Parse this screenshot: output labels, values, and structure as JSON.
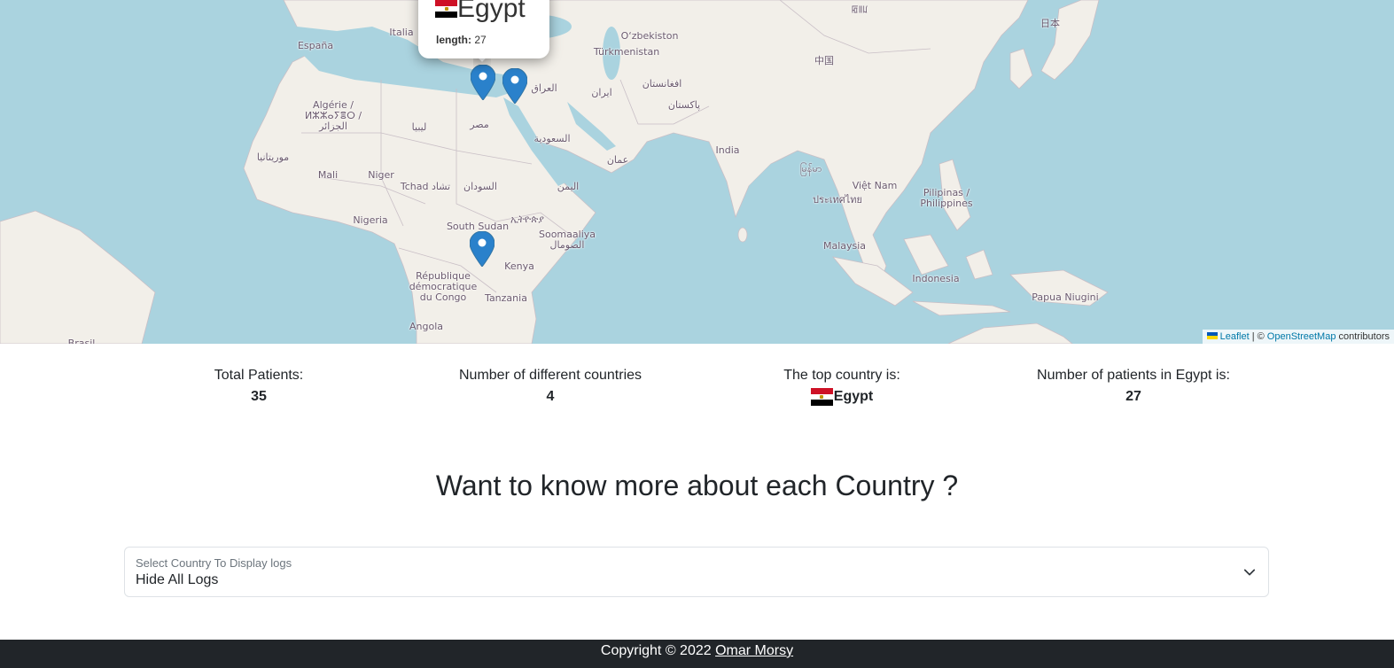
{
  "map": {
    "labels": [
      {
        "text": "España",
        "id": "label-espana"
      },
      {
        "text": "Italia",
        "id": "label-italia"
      },
      {
        "text": "O‘zbekiston",
        "id": "label-uzbekistan"
      },
      {
        "text": "Türkmenistan",
        "id": "label-turkmenistan"
      },
      {
        "text": "中国",
        "id": "label-china"
      },
      {
        "text": "日本",
        "id": "label-japan"
      },
      {
        "text": "ꡂ꡷ꡊ",
        "id": "label-mongolia"
      },
      {
        "text": "العراق",
        "id": "label-iraq"
      },
      {
        "text": "ایران",
        "id": "label-iran"
      },
      {
        "text": "افغانستان",
        "id": "label-afghanistan"
      },
      {
        "text": "پاکستان",
        "id": "label-pakistan"
      },
      {
        "text": "Algérie /\nⵍⵣⵣⴰⵢⴻⵔ /\nالجزائر",
        "id": "label-algeria"
      },
      {
        "text": "ليبيا",
        "id": "label-libya"
      },
      {
        "text": "مصر",
        "id": "label-egypt"
      },
      {
        "text": "السعودية",
        "id": "label-saudi"
      },
      {
        "text": "عمان",
        "id": "label-oman"
      },
      {
        "text": "India",
        "id": "label-india"
      },
      {
        "text": "မြန်မာ",
        "id": "label-myanmar"
      },
      {
        "text": "Việt Nam",
        "id": "label-vietnam"
      },
      {
        "text": "Pilipinas /\nPhilippines",
        "id": "label-philippines"
      },
      {
        "text": "ประเทศไทย",
        "id": "label-thailand"
      },
      {
        "text": "موريتانيا",
        "id": "label-mauritania"
      },
      {
        "text": "Mali",
        "id": "label-mali"
      },
      {
        "text": "Niger",
        "id": "label-niger"
      },
      {
        "text": "Tchad تشاد",
        "id": "label-chad"
      },
      {
        "text": "السودان",
        "id": "label-sudan"
      },
      {
        "text": "اليمن",
        "id": "label-yemen"
      },
      {
        "text": "Nigeria",
        "id": "label-nigeria"
      },
      {
        "text": "ኢትዮጵያ",
        "id": "label-ethiopia"
      },
      {
        "text": "South Sudan",
        "id": "label-south-sudan"
      },
      {
        "text": "Soomaaliya\nالصومال",
        "id": "label-somalia"
      },
      {
        "text": "Malaysia",
        "id": "label-malaysia"
      },
      {
        "text": "Kenya",
        "id": "label-kenya"
      },
      {
        "text": "République\ndémocratique\ndu Congo",
        "id": "label-drc"
      },
      {
        "text": "Tanzania",
        "id": "label-tanzania"
      },
      {
        "text": "Indonesia",
        "id": "label-indonesia"
      },
      {
        "text": "Papua Niugini",
        "id": "label-png"
      },
      {
        "text": "Angola",
        "id": "label-angola"
      },
      {
        "text": "Brasil",
        "id": "label-brasil"
      }
    ],
    "popup": {
      "title": "Egypt",
      "line_label": "length:",
      "line_value": "27"
    },
    "attribution": {
      "leaflet": "Leaflet",
      "separator": "| ©",
      "osm": "OpenStreetMap",
      "suffix": "contributors"
    }
  },
  "stats": [
    {
      "label": "Total Patients:",
      "value": "35"
    },
    {
      "label": "Number of different countries",
      "value": "4"
    },
    {
      "label": "The top country is:",
      "value": "Egypt",
      "flag": true
    },
    {
      "label": "Number of patients in Egypt is:",
      "value": "27"
    }
  ],
  "section_title": "Want to know more about each Country ?",
  "select": {
    "label": "Select Country To Display logs",
    "value": "Hide All Logs"
  },
  "footer": {
    "text": "Copyright © 2022",
    "author": "Omar Morsy"
  },
  "colors": {
    "water": "#aad3df",
    "land": "#f2efe9",
    "marker": "#2a81cb",
    "footer_bg": "#212529",
    "link": "#0078a8"
  }
}
